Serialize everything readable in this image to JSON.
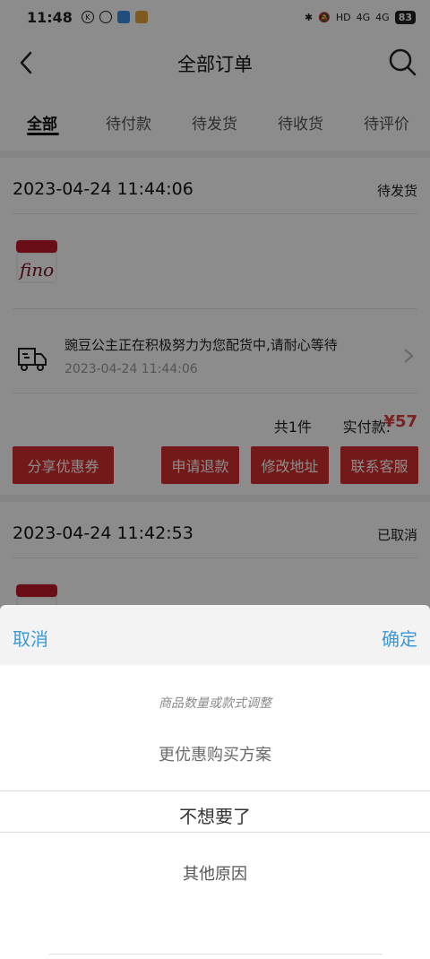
{
  "status_bar": {
    "time": "11:48",
    "network_1": "4G",
    "network_2": "4G",
    "hd": "HD",
    "battery": "83"
  },
  "header": {
    "title": "全部订单"
  },
  "tabs": [
    {
      "label": "全部"
    },
    {
      "label": "待付款"
    },
    {
      "label": "待发货"
    },
    {
      "label": "待收货"
    },
    {
      "label": "待评价"
    }
  ],
  "orders": [
    {
      "date": "2023-04-24 11:44:06",
      "status": "待发货",
      "product_label": "fino",
      "shipping_message": "豌豆公主正在积极努力为您配货中,请耐心等待",
      "shipping_time": "2023-04-24 11:44:06",
      "item_count": "共1件",
      "paid_label": "实付款:",
      "paid_value": "¥57",
      "buttons": {
        "share": "分享优惠券",
        "refund": "申请退款",
        "address": "修改地址",
        "service": "联系客服"
      }
    },
    {
      "date": "2023-04-24 11:42:53",
      "status": "已取消"
    }
  ],
  "picker": {
    "cancel": "取消",
    "confirm": "确定",
    "options": [
      "商品数量或款式调整",
      "更优惠购买方案",
      "不想要了",
      "其他原因"
    ],
    "selected_index": 2
  },
  "colors": {
    "accent_red": "#d32f2f",
    "price_red": "#e23b3b",
    "picker_link": "#3a9ad9"
  }
}
